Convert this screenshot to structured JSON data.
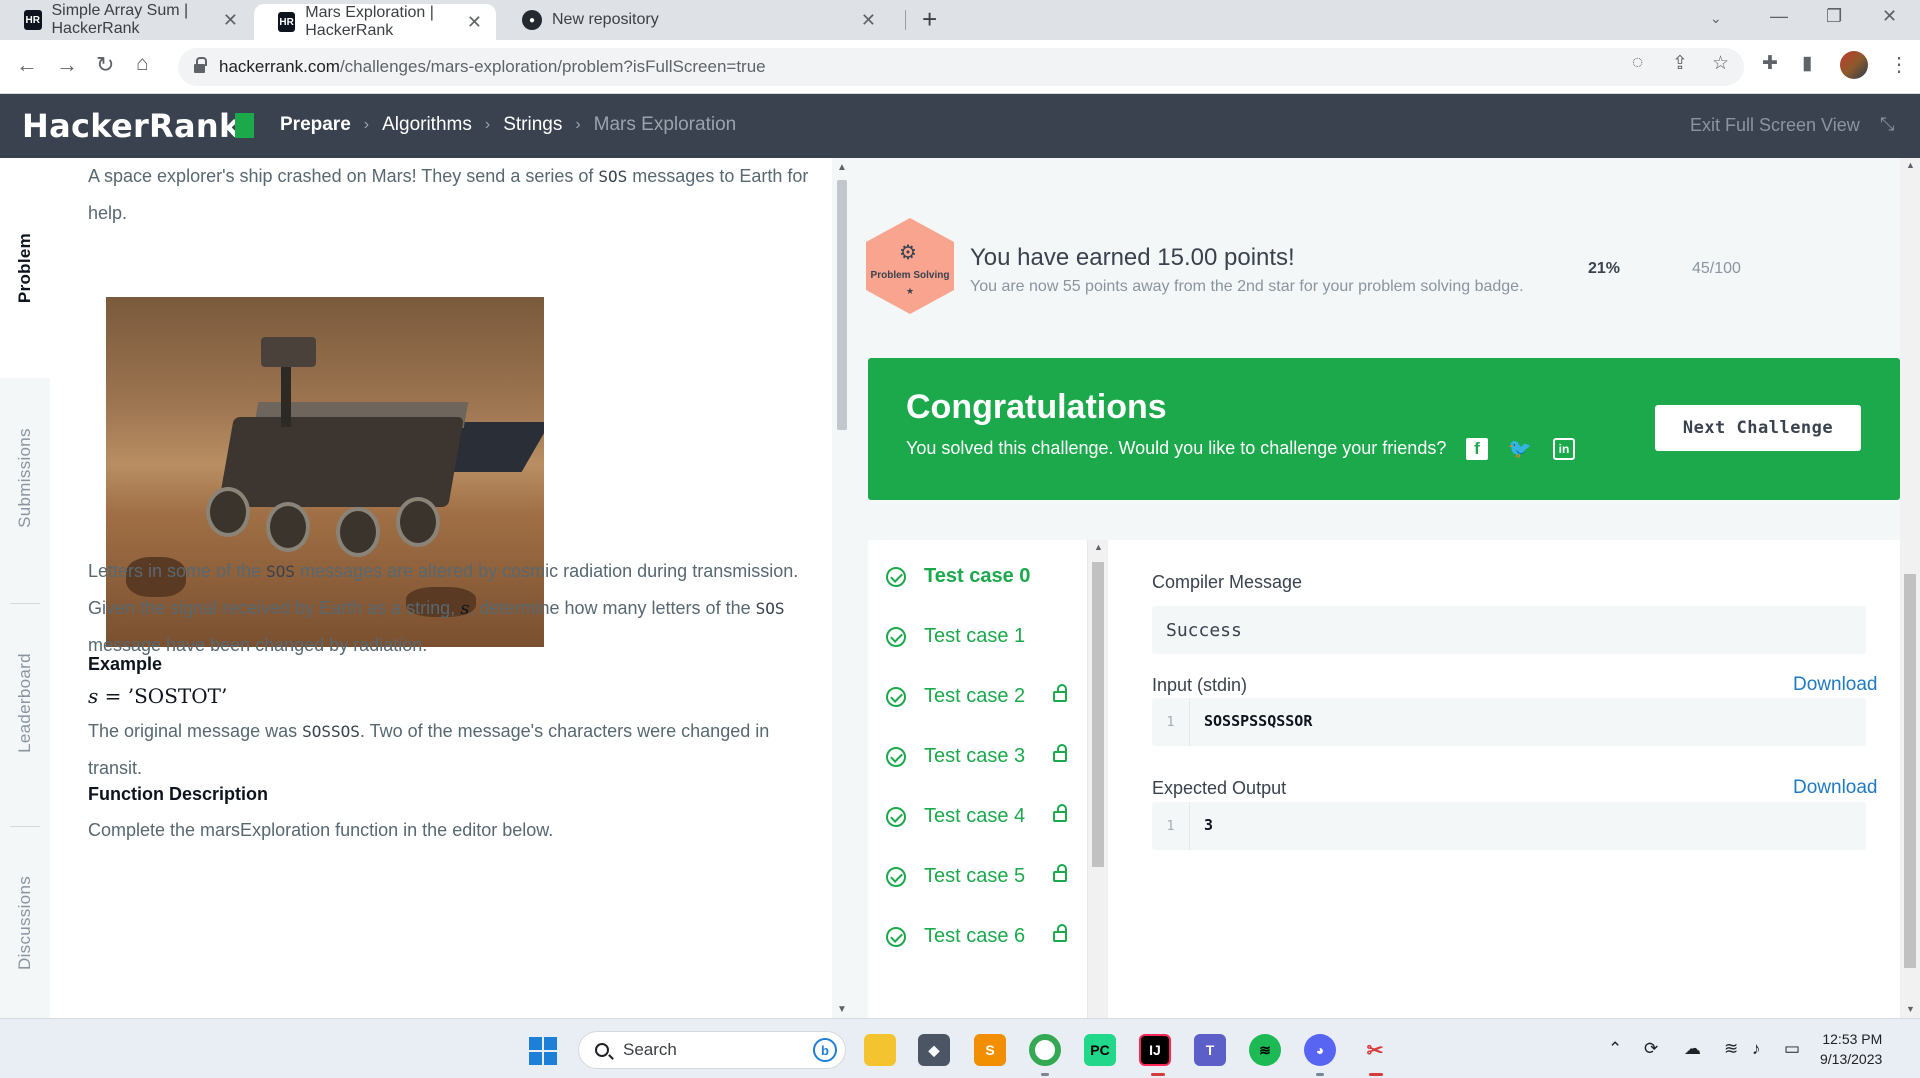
{
  "browser": {
    "tabs": [
      {
        "title": "Simple Array Sum | HackerRank",
        "favicon": "hackerrank-favicon",
        "active": false
      },
      {
        "title": "Mars Exploration | HackerRank",
        "favicon": "hackerrank-favicon",
        "active": true
      },
      {
        "title": "New repository",
        "favicon": "github-favicon",
        "active": false
      }
    ],
    "url_host": "hackerrank.com",
    "url_path": "/challenges/mars-exploration/problem?isFullScreen=true"
  },
  "header": {
    "logo": "HackerRank",
    "breadcrumbs": [
      "Prepare",
      "Algorithms",
      "Strings",
      "Mars Exploration"
    ],
    "exit_fullscreen": "Exit Full Screen View"
  },
  "side_tabs": [
    "Problem",
    "Submissions",
    "Leaderboard",
    "Discussions"
  ],
  "problem": {
    "intro_a": "A space explorer's ship crashed on Mars! They send a series of ",
    "intro_code": "SOS",
    "intro_b": " messages to Earth for help.",
    "p2_a": "Letters in some of the ",
    "p2_code1": "SOS",
    "p2_b": " messages are altered by cosmic radiation during transmission. Given the signal received by Earth as a string, ",
    "p2_var": "s",
    "p2_c": ", determine how many letters of the ",
    "p2_code2": "SOS",
    "p2_d": " message have been changed by radiation.",
    "example_heading": "Example",
    "example_var": "s",
    "example_eq": " = ",
    "example_value": "’SOSTOT’",
    "p3_a": "The original message was ",
    "p3_code": "SOSSOS",
    "p3_b": ". Two of the message's characters were changed in transit.",
    "function_heading": "Function Description",
    "p4": "Complete the marsExploration function in the editor below."
  },
  "badge": {
    "label": "Problem Solving",
    "stars": "★",
    "earned": "You have earned 15.00 points!",
    "sub": "You are now 55 points away from the 2nd star for your problem solving badge.",
    "percent": "21%",
    "points": "45/100"
  },
  "congrats": {
    "title": "Congratulations",
    "subtitle": "You solved this challenge. Would you like to challenge your friends?",
    "next_button": "Next Challenge",
    "social": [
      "f",
      "🐦",
      "in"
    ]
  },
  "test_cases": [
    {
      "label": "Test case 0",
      "locked": false
    },
    {
      "label": "Test case 1",
      "locked": false
    },
    {
      "label": "Test case 2",
      "locked": true
    },
    {
      "label": "Test case 3",
      "locked": true
    },
    {
      "label": "Test case 4",
      "locked": true
    },
    {
      "label": "Test case 5",
      "locked": true
    },
    {
      "label": "Test case 6",
      "locked": true
    }
  ],
  "result": {
    "compiler_label": "Compiler Message",
    "compiler_value": "Success",
    "input_label": "Input (stdin)",
    "input_line": "1",
    "input_value": "SOSSPSSQSSOR",
    "expected_label": "Expected Output",
    "expected_line": "1",
    "expected_value": "3",
    "download": "Download"
  },
  "taskbar": {
    "search": "Search",
    "time": "12:53 PM",
    "date": "9/13/2023"
  },
  "colors": {
    "hr_green": "#1ba94c",
    "hr_dark": "#39424e",
    "link_blue": "#1f7ac4"
  }
}
